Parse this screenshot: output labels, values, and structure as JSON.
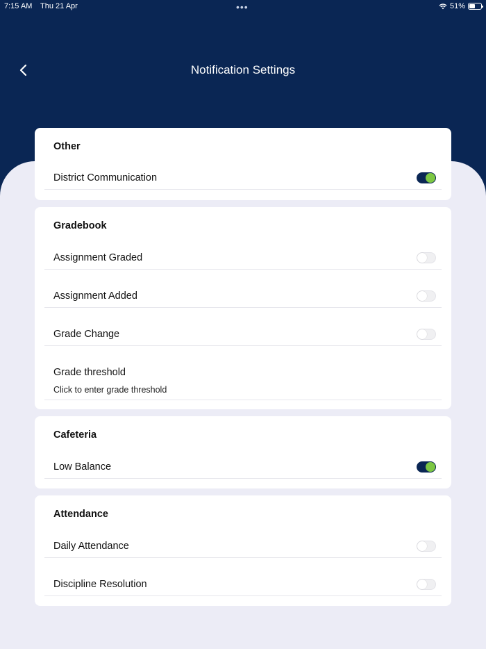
{
  "status_bar": {
    "time": "7:15 AM",
    "date": "Thu 21 Apr",
    "battery": "51%",
    "battery_level": 0.51
  },
  "header": {
    "title": "Notification Settings",
    "back_icon": "chevron-left-icon"
  },
  "colors": {
    "header_bg": "#0a2654",
    "page_bg": "#ececf6",
    "toggle_on_track": "#0a2654",
    "toggle_on_knob": "#7cc743"
  },
  "sections": [
    {
      "title": "Other",
      "rows": [
        {
          "label": "District Communication",
          "toggle": true
        }
      ]
    },
    {
      "title": "Gradebook",
      "rows": [
        {
          "label": "Assignment Graded",
          "toggle": false
        },
        {
          "label": "Assignment Added",
          "toggle": false
        },
        {
          "label": "Grade Change",
          "toggle": false
        },
        {
          "label": "Grade threshold",
          "subtitle": "Click to enter grade threshold"
        }
      ]
    },
    {
      "title": "Cafeteria",
      "rows": [
        {
          "label": "Low Balance",
          "toggle": true
        }
      ]
    },
    {
      "title": "Attendance",
      "rows": [
        {
          "label": "Daily Attendance",
          "toggle": false
        },
        {
          "label": "Discipline Resolution",
          "toggle": false
        }
      ]
    }
  ]
}
